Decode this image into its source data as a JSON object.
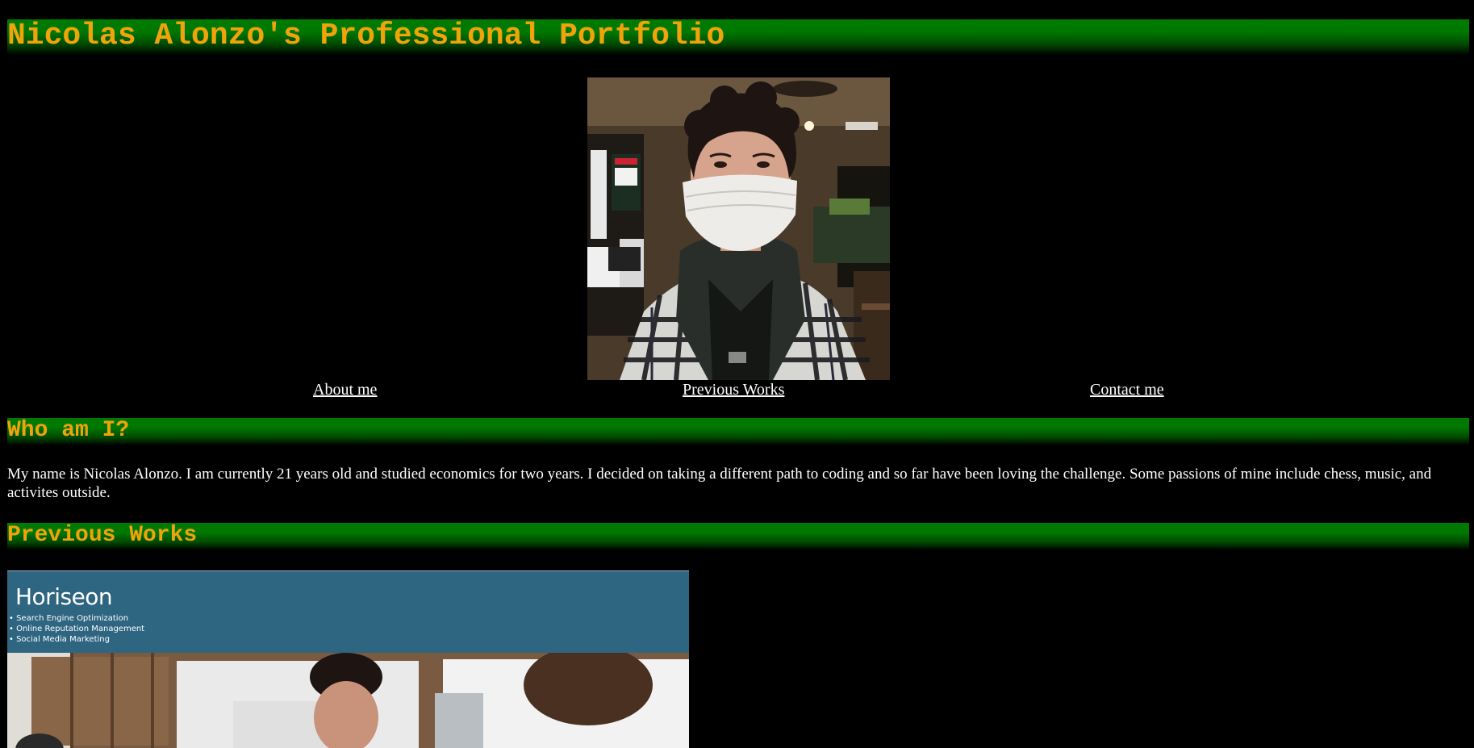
{
  "header": {
    "title": "Nicolas Alonzo's Professional Portfolio"
  },
  "nav": {
    "about": "About me",
    "works": "Previous Works",
    "contact": "Contact me"
  },
  "about": {
    "heading": "Who am I?",
    "body": "My name is Nicolas Alonzo. I am currently 21 years old and studied economics for two years. I decided on taking a different path to coding and so far have been loving the challenge. Some passions of mine include chess, music, and activites outside."
  },
  "works": {
    "heading": "Previous Works",
    "items": [
      {
        "brand": "Horiseon",
        "services": [
          "Search Engine Optimization",
          "Online Reputation Management",
          "Social Media Marketing"
        ]
      }
    ]
  },
  "colors": {
    "background": "#000000",
    "heading_text": "#f0a30a",
    "heading_bar": "#007a00",
    "body_text": "#ffffff",
    "horiseon_header": "#2e6581"
  }
}
